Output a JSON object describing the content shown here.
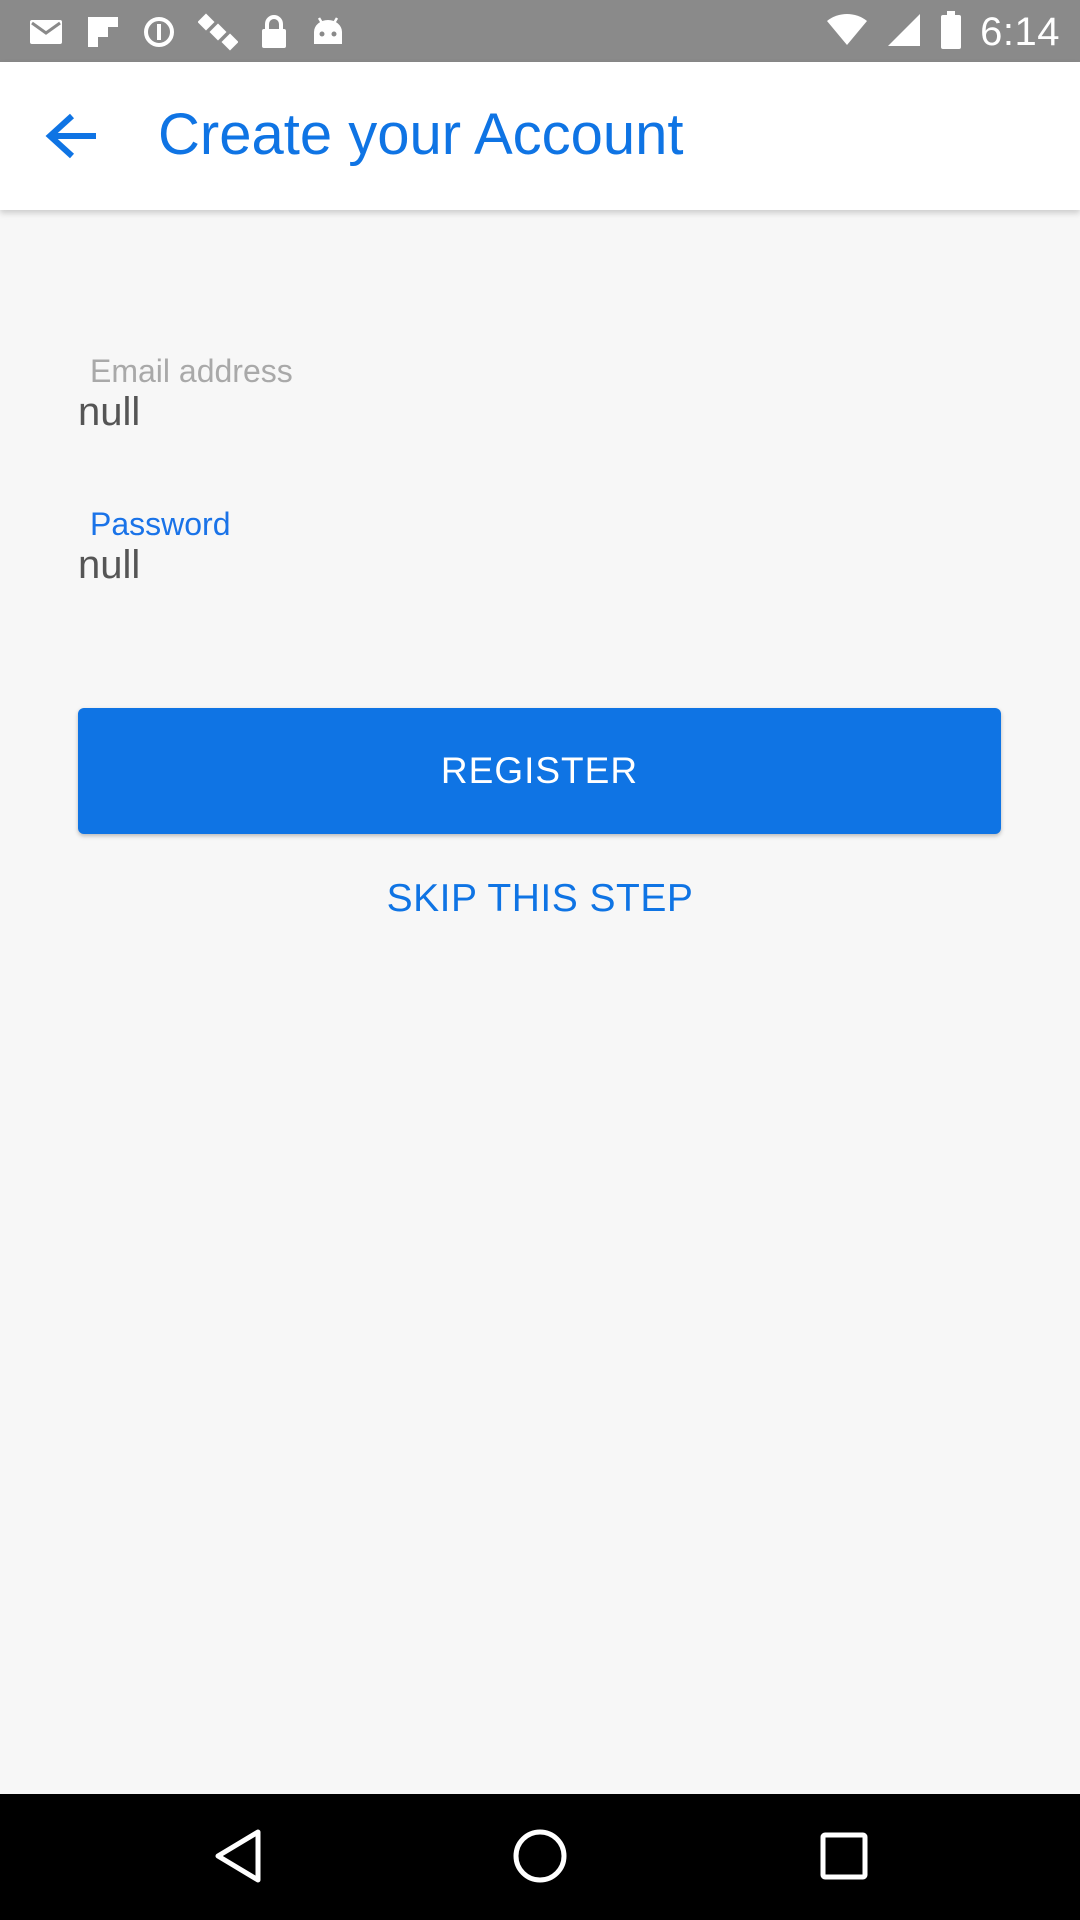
{
  "status_bar": {
    "time": "6:14",
    "icons": [
      "mail-icon",
      "flipboard-icon",
      "data-saver-icon",
      "satellite-icon",
      "lock-icon",
      "android-icon",
      "wifi-icon",
      "signal-icon",
      "battery-icon"
    ]
  },
  "app_bar": {
    "title": "Create your Account",
    "back_icon": "arrow-back-icon"
  },
  "form": {
    "email": {
      "label": "Email address",
      "value": "null"
    },
    "password": {
      "label": "Password",
      "value": "null"
    }
  },
  "actions": {
    "register_label": "REGISTER",
    "skip_label": "SKIP THIS STEP"
  },
  "nav_bar": {
    "icons": [
      "nav-back-icon",
      "nav-home-icon",
      "nav-recents-icon"
    ]
  },
  "colors": {
    "accent": "#0f74e4",
    "status_bar": "#8a8a8a",
    "background": "#f7f7f7",
    "nav_bar": "#000000"
  }
}
